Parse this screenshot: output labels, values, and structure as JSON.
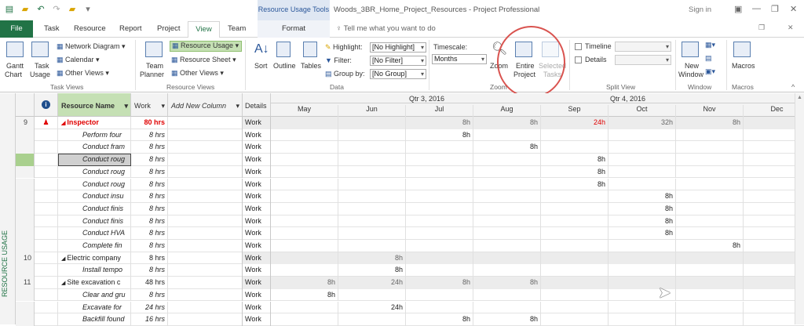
{
  "titlebar": {
    "tools_label": "Resource Usage Tools",
    "title": "Woods_3BR_Home_Project_Resources  -  Project Professional",
    "sign_in": "Sign in"
  },
  "tabs": {
    "file": "File",
    "task": "Task",
    "resource": "Resource",
    "report": "Report",
    "project": "Project",
    "view": "View",
    "team": "Team",
    "format": "Format",
    "tell_me": "Tell me what you want to do"
  },
  "ribbon": {
    "gantt_chart": "Gantt",
    "gantt_chart2": "Chart",
    "task_usage": "Task",
    "task_usage2": "Usage",
    "network_diagram": "Network Diagram",
    "calendar": "Calendar",
    "other_views": "Other Views",
    "task_views": "Task Views",
    "team_planner": "Team",
    "team_planner2": "Planner",
    "resource_usage": "Resource Usage",
    "resource_sheet": "Resource Sheet",
    "other_views2": "Other Views",
    "resource_views": "Resource Views",
    "sort": "Sort",
    "outline": "Outline",
    "tables": "Tables",
    "highlight_label": "Highlight:",
    "highlight_value": "[No Highlight]",
    "filter_label": "Filter:",
    "filter_value": "[No Filter]",
    "groupby_label": "Group by:",
    "groupby_value": "[No Group]",
    "data": "Data",
    "timescale_label": "Timescale:",
    "timescale_value": "Months",
    "zoom": "Zoom",
    "entire_project": "Entire",
    "entire_project2": "Project",
    "selected_tasks": "Selected",
    "selected_tasks2": "Tasks",
    "zoom_group": "Zoom",
    "timeline": "Timeline",
    "details": "Details",
    "split_view": "Split View",
    "new_window": "New",
    "new_window2": "Window",
    "window": "Window",
    "macros": "Macros",
    "macros_group": "Macros"
  },
  "sheet": {
    "side_label": "RESOURCE USAGE",
    "col_name": "Resource Name",
    "col_work": "Work",
    "col_add": "Add New Column",
    "col_details": "Details",
    "qtr3": "Qtr 3, 2016",
    "qtr4": "Qtr 4, 2016",
    "months": [
      "May",
      "Jun",
      "Jul",
      "Aug",
      "Sep",
      "Oct",
      "Nov",
      "Dec"
    ]
  },
  "rows": [
    {
      "id": "9",
      "name": "Inspector",
      "work": "80 hrs",
      "details": "Work",
      "type": "group",
      "overalloc": true,
      "vals": [
        "",
        "",
        "8h",
        "8h",
        "24h",
        "32h",
        "8h",
        ""
      ]
    },
    {
      "id": "",
      "name": "Perform four",
      "work": "8 hrs",
      "details": "Work",
      "type": "task",
      "vals": [
        "",
        "",
        "8h",
        "",
        "",
        "",
        "",
        ""
      ]
    },
    {
      "id": "",
      "name": "Conduct fram",
      "work": "8 hrs",
      "details": "Work",
      "type": "task",
      "vals": [
        "",
        "",
        "",
        "8h",
        "",
        "",
        "",
        ""
      ]
    },
    {
      "id": "",
      "name": "Conduct roug",
      "work": "8 hrs",
      "details": "Work",
      "type": "selected",
      "vals": [
        "",
        "",
        "",
        "",
        "8h",
        "",
        "",
        ""
      ]
    },
    {
      "id": "",
      "name": "Conduct roug",
      "work": "8 hrs",
      "details": "Work",
      "type": "task",
      "vals": [
        "",
        "",
        "",
        "",
        "8h",
        "",
        "",
        ""
      ]
    },
    {
      "id": "",
      "name": "Conduct roug",
      "work": "8 hrs",
      "details": "Work",
      "type": "task",
      "vals": [
        "",
        "",
        "",
        "",
        "8h",
        "",
        "",
        ""
      ]
    },
    {
      "id": "",
      "name": "Conduct insu",
      "work": "8 hrs",
      "details": "Work",
      "type": "task",
      "vals": [
        "",
        "",
        "",
        "",
        "",
        "8h",
        "",
        ""
      ]
    },
    {
      "id": "",
      "name": "Conduct finis",
      "work": "8 hrs",
      "details": "Work",
      "type": "task",
      "vals": [
        "",
        "",
        "",
        "",
        "",
        "8h",
        "",
        ""
      ]
    },
    {
      "id": "",
      "name": "Conduct finis",
      "work": "8 hrs",
      "details": "Work",
      "type": "task",
      "vals": [
        "",
        "",
        "",
        "",
        "",
        "8h",
        "",
        ""
      ]
    },
    {
      "id": "",
      "name": "Conduct HVA",
      "work": "8 hrs",
      "details": "Work",
      "type": "task",
      "vals": [
        "",
        "",
        "",
        "",
        "",
        "8h",
        "",
        ""
      ]
    },
    {
      "id": "",
      "name": "Complete fin",
      "work": "8 hrs",
      "details": "Work",
      "type": "task",
      "vals": [
        "",
        "",
        "",
        "",
        "",
        "",
        "8h",
        ""
      ]
    },
    {
      "id": "10",
      "name": "Electric company",
      "work": "8 hrs",
      "details": "Work",
      "type": "group",
      "vals": [
        "",
        "8h",
        "",
        "",
        "",
        "",
        "",
        ""
      ]
    },
    {
      "id": "",
      "name": "Install tempo",
      "work": "8 hrs",
      "details": "Work",
      "type": "task",
      "vals": [
        "",
        "8h",
        "",
        "",
        "",
        "",
        "",
        ""
      ]
    },
    {
      "id": "11",
      "name": "Site excavation c",
      "work": "48 hrs",
      "details": "Work",
      "type": "group",
      "vals": [
        "8h",
        "24h",
        "8h",
        "8h",
        "",
        "",
        "",
        ""
      ]
    },
    {
      "id": "",
      "name": "Clear and gru",
      "work": "8 hrs",
      "details": "Work",
      "type": "task",
      "vals": [
        "8h",
        "",
        "",
        "",
        "",
        "",
        "",
        ""
      ]
    },
    {
      "id": "",
      "name": "Excavate for",
      "work": "24 hrs",
      "details": "Work",
      "type": "task",
      "vals": [
        "",
        "24h",
        "",
        "",
        "",
        "",
        "",
        ""
      ]
    },
    {
      "id": "",
      "name": "Backfill found",
      "work": "16 hrs",
      "details": "Work",
      "type": "task",
      "vals": [
        "",
        "",
        "8h",
        "8h",
        "",
        "",
        "",
        ""
      ]
    }
  ],
  "colors": {
    "accent": "#217346",
    "overalloc": "#e00000",
    "selected_row": "#a9d08e"
  }
}
